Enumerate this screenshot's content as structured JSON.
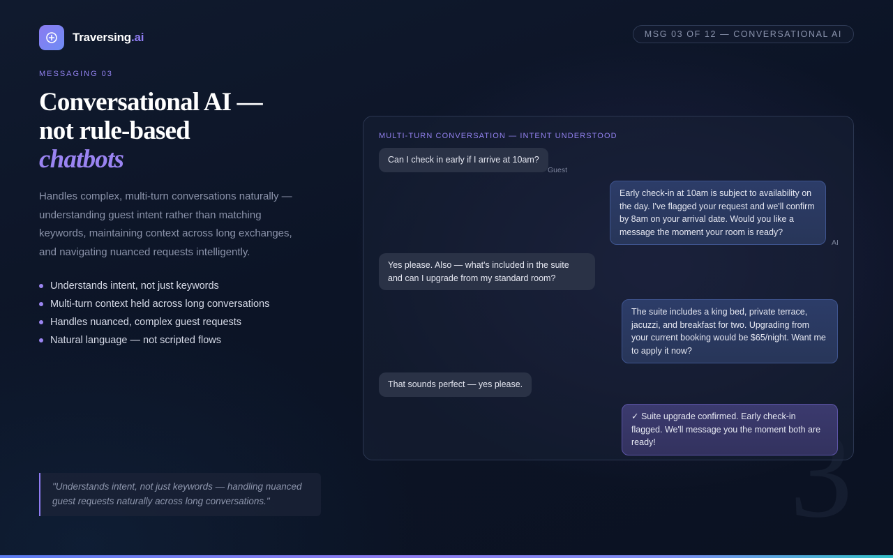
{
  "brand": {
    "name": "Traversing",
    "tld": ".ai"
  },
  "badge": "MSG 03 OF 12 — CONVERSATIONAL AI",
  "hero": {
    "eyebrow": "MESSAGING 03",
    "title_line1": "Conversational AI —",
    "title_line2": "not rule-based",
    "title_accent": "chatbots",
    "lead": "Handles complex, multi-turn conversations naturally — understanding guest intent rather than matching keywords, maintaining context across long exchanges, and navigating nuanced requests intelligently."
  },
  "features": [
    "Understands intent, not just keywords",
    "Multi-turn context held across long conversations",
    "Handles nuanced, complex guest requests",
    "Natural language — not scripted flows"
  ],
  "quote": "\"Understands intent, not just keywords — handling nuanced guest requests naturally across long conversations.\"",
  "chat": {
    "label": "MULTI-TURN CONVERSATION — INTENT UNDERSTOOD",
    "messages": [
      {
        "role": "guest",
        "text": "Can I check in early if I arrive at 10am?",
        "tag": "Guest"
      },
      {
        "role": "ai",
        "text": "Early check-in at 10am is subject to availability on the day. I've flagged your request and we'll confirm by 8am on your arrival date. Would you like a message the moment your room is ready?",
        "tag": "AI"
      },
      {
        "role": "guest",
        "text": "Yes please. Also — what's included in the suite and can I upgrade from my standard room?"
      },
      {
        "role": "ai",
        "text": "The suite includes a king bed, private terrace, jacuzzi, and breakfast for two. Upgrading from your current booking would be $65/night. Want me to apply it now?"
      },
      {
        "role": "guest",
        "text": "That sounds perfect — yes please."
      },
      {
        "role": "ai",
        "text": "✓ Suite upgrade confirmed. Early check-in flagged. We'll message you the moment both are ready!"
      }
    ]
  },
  "slide_number": "3",
  "colors": {
    "accent": "#9382f0",
    "background": "#0c1426",
    "ai_bubble": "#2c3c68",
    "guest_bubble": "#2a3246"
  },
  "icons": {
    "logo": "circle-plus-icon"
  }
}
